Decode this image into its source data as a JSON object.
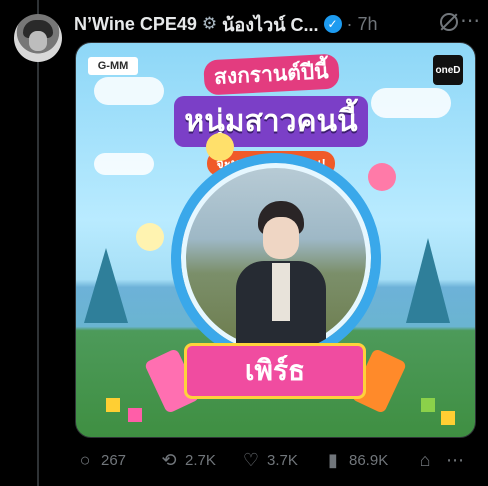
{
  "post": {
    "display_name": "N’Wine CPE49",
    "handle_text": "น้องไวน์ C...",
    "time": "7h",
    "icons": {
      "name_badge": "gear-badge-icon",
      "verified": "verified-check-icon",
      "grok": "grok-icon",
      "more": "more-icon"
    }
  },
  "media": {
    "logo_left": "G-MM",
    "logo_right": "oneD",
    "headline_top": "สงกรานต์ปีนี้",
    "headline_main": "หนุ่มสาวคนนี้",
    "headline_sub": "จะมาสาดน้ำใส่คุณ!",
    "banner_name": "เพิร์ธ"
  },
  "actions": {
    "replies": "267",
    "reposts": "2.7K",
    "likes": "3.7K",
    "views": "86.9K",
    "icons": [
      "reply-icon",
      "repost-icon",
      "like-icon",
      "views-icon",
      "bookmark-icon",
      "share-icon"
    ]
  }
}
